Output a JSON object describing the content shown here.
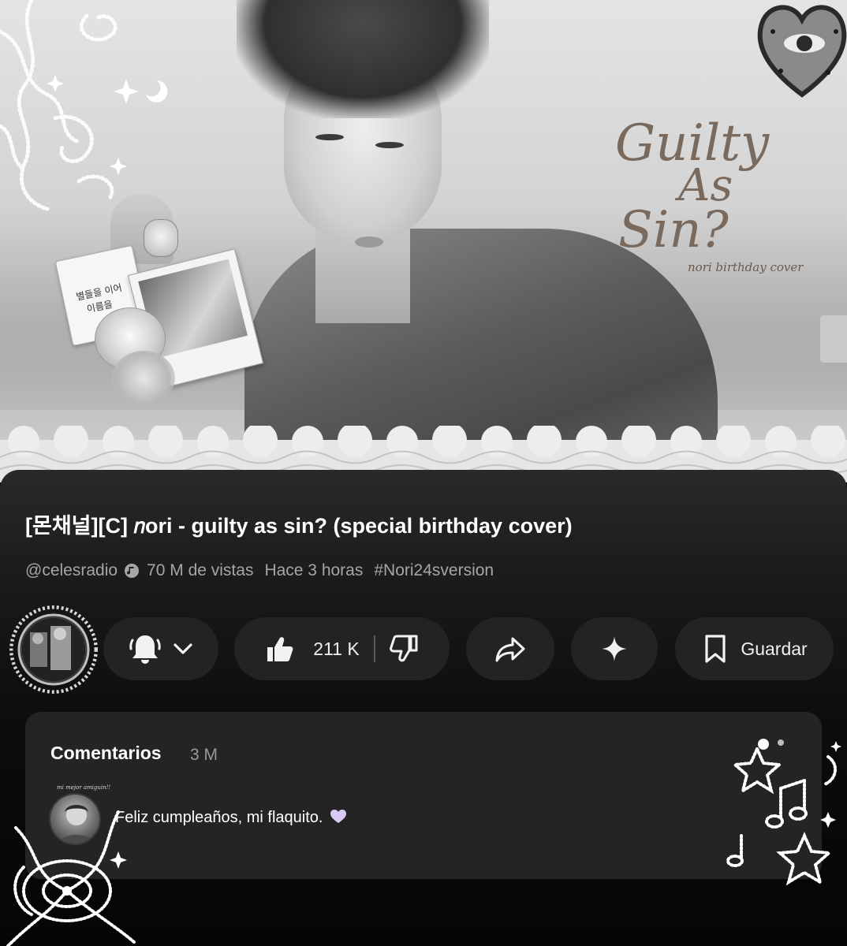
{
  "thumbnail": {
    "cover_title_line1": "Guilty",
    "cover_title_line2": "As",
    "cover_title_line3": "Sin?",
    "cover_subtitle": "nori birthday cover",
    "note_text_line1": "별들을 이어",
    "note_text_line2": "이름을"
  },
  "video": {
    "title": "[몬채널][C] 𝑛ori - guilty as sin? (special birthday cover)",
    "channel_handle": "@celesradio",
    "views": "70 M de vistas",
    "posted": "Hace 3 horas",
    "hashtag": "#Nori24sversion"
  },
  "actions": {
    "likes": "211 K",
    "save_label": "Guardar"
  },
  "comments": {
    "title": "Comentarios",
    "count": "3 M",
    "top_comment": {
      "commenter_note": "mi mejor amiguin!!",
      "text": "Feliz cumpleaños, mi flaquito."
    }
  },
  "icons": {
    "bell": "bell-icon",
    "chevron": "chevron-down-icon",
    "like": "thumbs-up-icon",
    "dislike": "thumbs-down-icon",
    "share": "share-icon",
    "sparkle": "sparkle-icon",
    "save": "bookmark-icon",
    "verified": "verified-music-icon",
    "heart": "heart-icon"
  },
  "colors": {
    "panel_background": "#1a1919",
    "pill_background": "#242323",
    "card_background": "#242424",
    "muted_text": "#a6a6a6",
    "heart_emoji": "#d9c9f5",
    "cover_title": "#7a6a5e"
  }
}
